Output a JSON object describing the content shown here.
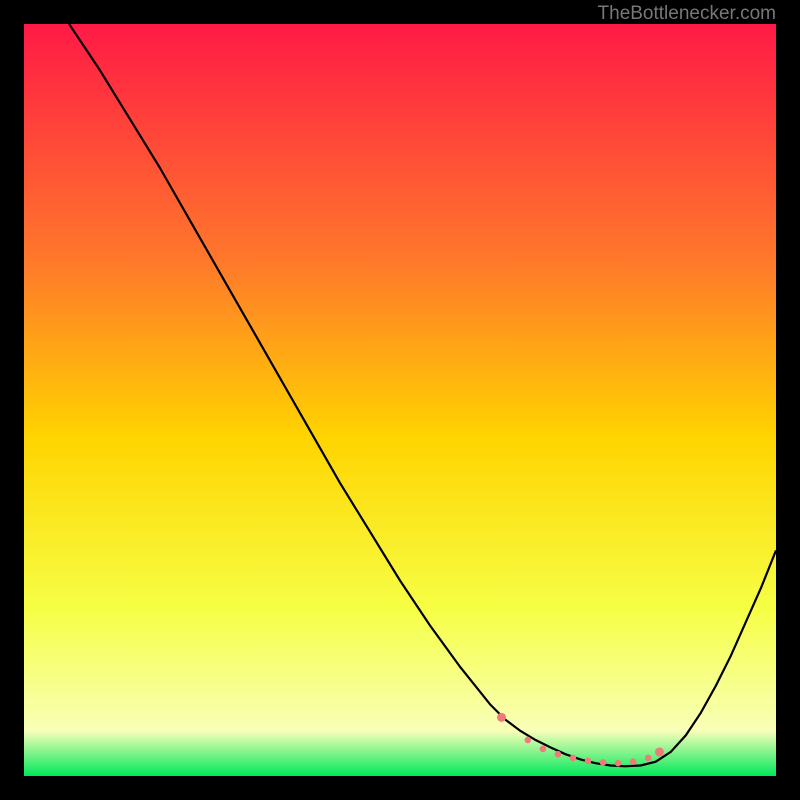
{
  "watermark": "TheBottlenecker.com",
  "colors": {
    "top": "#ff1a46",
    "upper_mid": "#ff7a2a",
    "mid": "#ffd400",
    "lower_mid": "#f6ff46",
    "near_bottom": "#f8ffb8",
    "bottom": "#00e85a",
    "curve": "#000000",
    "marker": "#f07a7a",
    "background": "#000000",
    "watermark_text": "#777777"
  },
  "chart_data": {
    "type": "line",
    "title": "",
    "xlabel": "",
    "ylabel": "",
    "xlim": [
      0,
      100
    ],
    "ylim": [
      0,
      100
    ],
    "series": [
      {
        "name": "bottleneck-curve",
        "x": [
          6,
          10,
          14,
          18,
          22,
          26,
          30,
          34,
          38,
          42,
          46,
          50,
          54,
          58,
          62,
          64,
          66,
          68,
          70,
          72,
          74,
          76,
          78,
          80,
          82,
          84,
          86,
          88,
          90,
          92,
          94,
          96,
          98,
          100
        ],
        "y": [
          100,
          94,
          87.5,
          81,
          74,
          67,
          60,
          53,
          46,
          39,
          32.5,
          26,
          20,
          14.5,
          9.5,
          7.5,
          6,
          4.8,
          3.8,
          2.9,
          2.2,
          1.7,
          1.4,
          1.3,
          1.4,
          1.9,
          3.2,
          5.4,
          8.4,
          12,
          16,
          20.5,
          25,
          30
        ]
      }
    ],
    "markers": {
      "name": "trough-dots",
      "x": [
        63.5,
        67,
        69,
        71,
        73,
        75,
        77,
        79,
        81,
        83,
        84.5
      ],
      "y": [
        7.8,
        4.8,
        3.6,
        2.9,
        2.4,
        2.0,
        1.8,
        1.7,
        1.9,
        2.4,
        3.2
      ]
    }
  }
}
